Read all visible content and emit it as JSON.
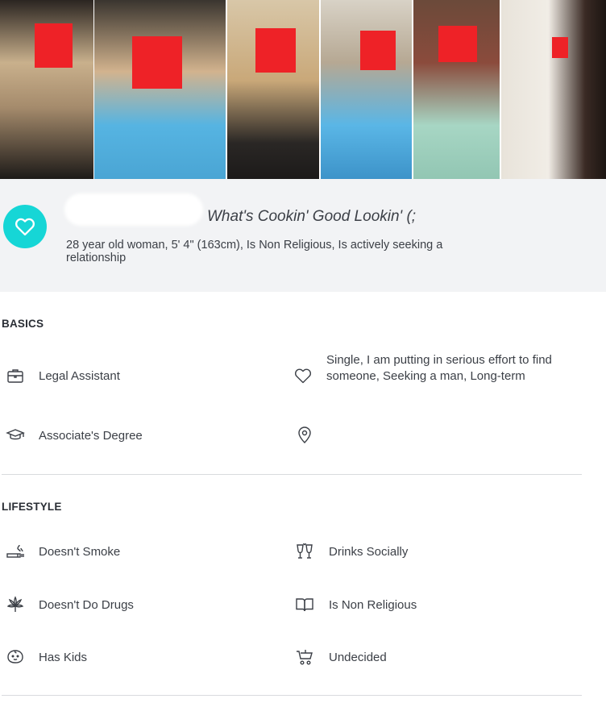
{
  "profile": {
    "tagline": "What's Cookin' Good Lookin' (;",
    "summary": "28 year old woman, 5' 4\" (163cm), Is Non Religious, Is actively seeking a relationship"
  },
  "photos": [
    {
      "alt": "photo-1",
      "colors": [
        "#2b2521",
        "#c9b08c"
      ]
    },
    {
      "alt": "photo-2",
      "colors": [
        "#3a352f",
        "#56b4e2"
      ]
    },
    {
      "alt": "photo-3",
      "colors": [
        "#d8c7a8",
        "#2a2725"
      ]
    },
    {
      "alt": "photo-4",
      "colors": [
        "#d8d2c6",
        "#5ab6e6"
      ]
    },
    {
      "alt": "photo-5",
      "colors": [
        "#6b4a3a",
        "#a7d6c4"
      ]
    },
    {
      "alt": "photo-6",
      "colors": [
        "#f1ede6",
        "#3a2a24"
      ]
    }
  ],
  "basics": {
    "title": "BASICS",
    "occupation": "Legal Assistant",
    "relationship": "Single, I am putting in serious effort to find someone, Seeking a man, Long-term",
    "education": "Associate's Degree",
    "location": ""
  },
  "lifestyle": {
    "title": "LIFESTYLE",
    "smoking": "Doesn't Smoke",
    "drinking": "Drinks Socially",
    "drugs": "Doesn't Do Drugs",
    "religion": "Is Non Religious",
    "kids": "Has Kids",
    "want_kids": "Undecided"
  },
  "colors": {
    "accent": "#16d6d6",
    "redaction": "#ee2227",
    "header_bg": "#f2f3f5"
  },
  "icons": [
    "briefcase-icon",
    "heart-outline-icon",
    "graduation-cap-icon",
    "map-pin-icon",
    "smoking-icon",
    "wine-glasses-icon",
    "cannabis-leaf-icon",
    "book-icon",
    "baby-face-icon",
    "stroller-icon"
  ]
}
